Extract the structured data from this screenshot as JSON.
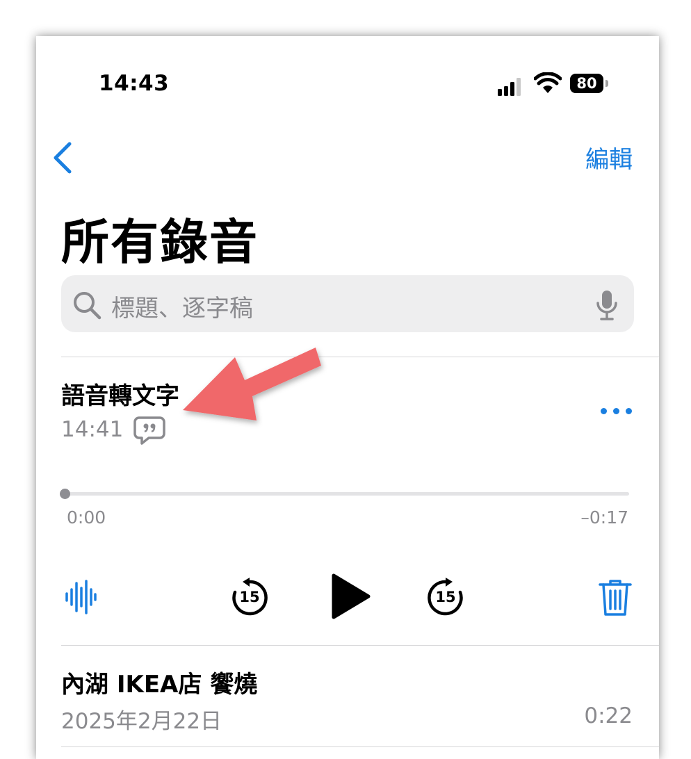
{
  "status_bar": {
    "time": "14:43",
    "battery": "80"
  },
  "nav": {
    "edit_label": "編輯"
  },
  "page_title": "所有錄音",
  "search": {
    "placeholder": "標題、逐字稿"
  },
  "recordings": [
    {
      "title": "語音轉文字",
      "time": "14:41",
      "elapsed": "0:00",
      "remaining": "–0:17",
      "progress": 0
    },
    {
      "title": "內湖 IKEA店 饗燒",
      "date": "2025年2月22日",
      "duration": "0:22"
    }
  ],
  "player": {
    "skip_back_seconds": "15",
    "skip_forward_seconds": "15"
  },
  "icons": {
    "back": "chevron-left-icon",
    "search": "magnifier-icon",
    "mic": "microphone-icon",
    "more": "ellipsis-icon",
    "transcript": "quote-bubble-icon",
    "waveform": "waveform-icon",
    "skip_back": "rewind-15-icon",
    "play": "play-icon",
    "skip_forward": "forward-15-icon",
    "delete": "trash-icon"
  },
  "colors": {
    "accent": "#1a7fe0",
    "annotation_arrow": "#f0686a",
    "secondary_text": "#8a8a8e"
  }
}
